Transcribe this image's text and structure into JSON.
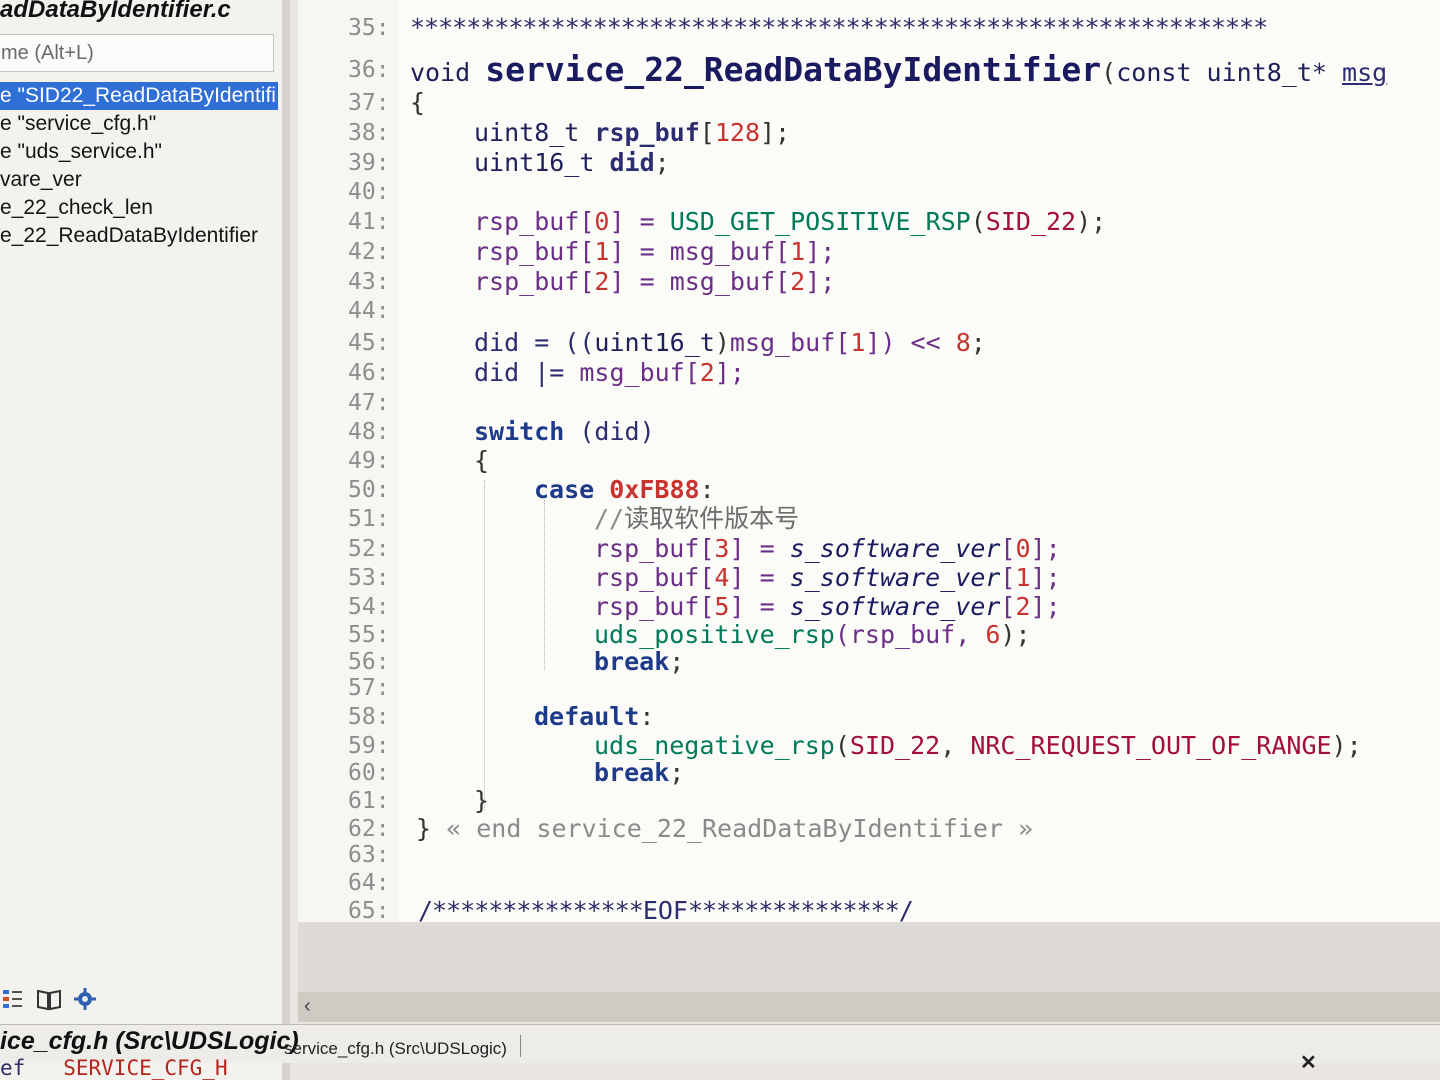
{
  "left_panel": {
    "title": "adDataByIdentifier.c",
    "search_placeholder": "me (Alt+L)",
    "symbols": [
      "e \"SID22_ReadDataByIdentifi",
      "e \"service_cfg.h\"",
      "e \"uds_service.h\"",
      "vare_ver",
      "e_22_check_len",
      "e_22_ReadDataByIdentifier"
    ],
    "selected_index": 0
  },
  "editor": {
    "lines": [
      {
        "n": "35:"
      },
      {
        "n": "36:"
      },
      {
        "n": "37:"
      },
      {
        "n": "38:"
      },
      {
        "n": "39:"
      },
      {
        "n": "40:"
      },
      {
        "n": "41:"
      },
      {
        "n": "42:"
      },
      {
        "n": "43:"
      },
      {
        "n": "44:"
      },
      {
        "n": "45:"
      },
      {
        "n": "46:"
      },
      {
        "n": "47:"
      },
      {
        "n": "48:"
      },
      {
        "n": "49:"
      },
      {
        "n": "50:"
      },
      {
        "n": "51:"
      },
      {
        "n": "52:"
      },
      {
        "n": "53:"
      },
      {
        "n": "54:"
      },
      {
        "n": "55:"
      },
      {
        "n": "56:"
      },
      {
        "n": "57:"
      },
      {
        "n": "58:"
      },
      {
        "n": "59:"
      },
      {
        "n": "60:"
      },
      {
        "n": "61:"
      },
      {
        "n": "62:"
      },
      {
        "n": "63:"
      },
      {
        "n": "64:"
      },
      {
        "n": "65:"
      }
    ],
    "code": {
      "l35_stars": "*************************************************************",
      "l36_void": "void ",
      "l36_fn": "service_22_ReadDataByIdentifier",
      "l36_paren": "(",
      "l36_const": "const ",
      "l36_type": "uint8_t* ",
      "l36_arg": "msg",
      "l37": "{",
      "l38_type": "uint8_t ",
      "l38_var": "rsp_buf",
      "l38_lb": "[",
      "l38_num": "128",
      "l38_rb": "];",
      "l39_type": "uint16_t ",
      "l39_var": "did",
      "l39_semi": ";",
      "l41_a": "rsp_buf[",
      "l41_i": "0",
      "l41_b": "] = ",
      "l41_mac": "USD_GET_POSITIVE_RSP",
      "l41_p": "(",
      "l41_sid": "SID_22",
      "l41_e": ");",
      "l42_a": "rsp_buf[",
      "l42_i": "1",
      "l42_b": "] = ",
      "l42_c": "msg_buf[",
      "l42_j": "1",
      "l42_e": "];",
      "l43_a": "rsp_buf[",
      "l43_i": "2",
      "l43_b": "] = ",
      "l43_c": "msg_buf[",
      "l43_j": "2",
      "l43_e": "];",
      "l45_a": "did = ((",
      "l45_t": "uint16_t",
      "l45_b": ")",
      "l45_c": "msg_buf[",
      "l45_i": "1",
      "l45_d": "]) << ",
      "l45_n": "8",
      "l45_e": ";",
      "l46_a": "did |= ",
      "l46_c": "msg_buf[",
      "l46_i": "2",
      "l46_e": "];",
      "l48_kw": "switch",
      "l48_rest": " (did)",
      "l49": "{",
      "l50_kw": "case ",
      "l50_num": "0xFB88",
      "l50_colon": ":",
      "l51_cmt": "//",
      "l51_cn": "读取软件版本号",
      "l52_a": "rsp_buf[",
      "l52_i": "3",
      "l52_b": "] = ",
      "l52_g": "s_software_ver",
      "l52_c": "[",
      "l52_j": "0",
      "l52_e": "];",
      "l53_a": "rsp_buf[",
      "l53_i": "4",
      "l53_b": "] = ",
      "l53_g": "s_software_ver",
      "l53_c": "[",
      "l53_j": "1",
      "l53_e": "];",
      "l54_a": "rsp_buf[",
      "l54_i": "5",
      "l54_b": "] = ",
      "l54_g": "s_software_ver",
      "l54_c": "[",
      "l54_j": "2",
      "l54_e": "];",
      "l55_fn": "uds_positive_rsp",
      "l55_a": "(rsp_buf, ",
      "l55_n": "6",
      "l55_e": ");",
      "l56_kw": "break",
      "l56_e": ";",
      "l58_kw": "default",
      "l58_e": ":",
      "l59_fn": "uds_negative_rsp",
      "l59_p": "(",
      "l59_sid": "SID_22",
      "l59_c": ", ",
      "l59_nrc": "NRC_REQUEST_OUT_OF_RANGE",
      "l59_e": ");",
      "l60_kw": "break",
      "l60_e": ";",
      "l61": "}",
      "l62_b": "}",
      "l62_cmt": " « end service_22_ReadDataByIdentifier »",
      "l65_a": "/***************",
      "l65_eof": "EOF",
      "l65_b": "***************/"
    }
  },
  "status": {
    "file_bold": "ice_cfg.h (Src\\UDSLogic)",
    "file_small": "service_cfg.h (Src\\UDSLogic)"
  },
  "bottom": {
    "prefix": "ef",
    "macro": "SERVICE_CFG_H"
  },
  "icons": {
    "toolbar": [
      "list-icon",
      "book-icon",
      "gear-icon"
    ],
    "close": "close-icon",
    "scroll_left": "chevron-left-icon"
  }
}
